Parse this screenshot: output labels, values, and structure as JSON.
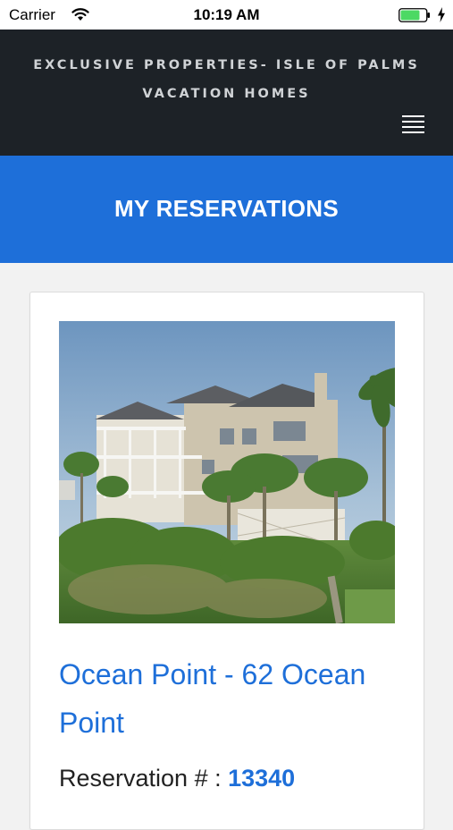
{
  "status_bar": {
    "carrier": "Carrier",
    "time": "10:19 AM",
    "battery_color": "#4cd964"
  },
  "header": {
    "title_line1": "EXCLUSIVE PROPERTIES- ISLE OF PALMS",
    "title_line2": "VACATION HOMES",
    "menu_icon": "hamburger-menu-icon"
  },
  "banner": {
    "title": "MY RESERVATIONS"
  },
  "reservation": {
    "property_name": "Ocean Point - 62 Ocean Point",
    "reservation_label": "Reservation # : ",
    "reservation_number": "13340",
    "photo_description": "beach-house-photo"
  },
  "colors": {
    "header_bg": "#1d2227",
    "accent_blue": "#1e6fd9",
    "page_bg": "#f2f2f2"
  }
}
